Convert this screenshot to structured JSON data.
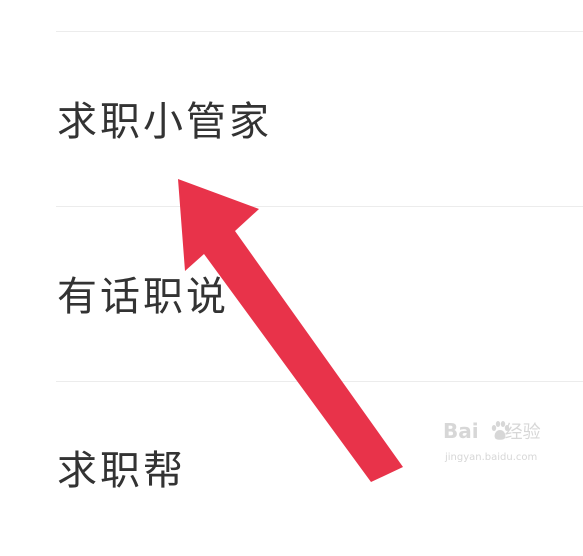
{
  "menu": {
    "items": [
      {
        "label": "求职小管家"
      },
      {
        "label": "有话职说"
      },
      {
        "label": "求职帮"
      }
    ]
  },
  "watermark": {
    "logo": "Bai",
    "logo_suffix": "经验",
    "site": "jingyan.baidu.com"
  },
  "colors": {
    "arrow": "#e8334a",
    "divider": "#ececec",
    "text": "#333333"
  }
}
